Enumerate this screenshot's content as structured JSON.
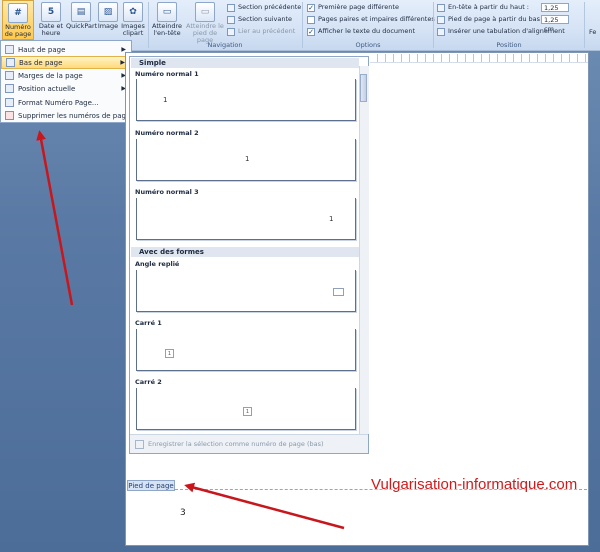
{
  "ribbon": {
    "buttons": [
      {
        "label_line1": "Numéro",
        "label_line2": "de page"
      },
      {
        "label_line1": "Date et",
        "label_line2": "heure"
      },
      {
        "label_line1": "QuickPart",
        "label_line2": ""
      },
      {
        "label_line1": "Image",
        "label_line2": ""
      },
      {
        "label_line1": "Images",
        "label_line2": "clipart"
      }
    ],
    "nav_buttons": [
      {
        "label_line1": "Atteindre",
        "label_line2": "l'en-tête"
      },
      {
        "label_line1": "Atteindre le",
        "label_line2": "pied de page"
      }
    ],
    "nav_rows": [
      "Section précédente",
      "Section suivante",
      "Lier au précédent"
    ],
    "nav_group": "Navigation",
    "options": [
      {
        "label": "Première page différente",
        "checked": true
      },
      {
        "label": "Pages paires et impaires différentes",
        "checked": false
      },
      {
        "label": "Afficher le texte du document",
        "checked": true
      }
    ],
    "options_group": "Options",
    "position": [
      {
        "label": "En-tête à partir du haut :",
        "value": "1,25 cm"
      },
      {
        "label": "Pied de page à partir du bas :",
        "value": "1,25 cm"
      }
    ],
    "position_row3": "Insérer une tabulation d'alignement",
    "position_group": "Position",
    "right_cut_label": "Fe"
  },
  "menu": {
    "items": [
      {
        "label": "Haut de page",
        "submenu": true
      },
      {
        "label": "Bas de page",
        "submenu": true,
        "selected": true
      },
      {
        "label": "Marges de la page",
        "submenu": true
      },
      {
        "label": "Position actuelle",
        "submenu": true
      },
      {
        "label": "Format Numéro Page...",
        "submenu": false
      },
      {
        "label": "Supprimer les numéros de page",
        "submenu": false
      }
    ]
  },
  "gallery": {
    "section_simple": "Simple",
    "section_formes": "Avec des formes",
    "items": [
      {
        "label": "Numéro normal 1"
      },
      {
        "label": "Numéro normal 2"
      },
      {
        "label": "Numéro normal 3"
      },
      {
        "label": "Angle replié"
      },
      {
        "label": "Carré 1"
      },
      {
        "label": "Carré 2"
      }
    ],
    "thumb_number": "1",
    "footer_action": "Enregistrer la sélection comme numéro de page (bas)"
  },
  "document": {
    "footer_tab": "Pied de page",
    "page_number": "3",
    "watermark": "Vulgarisation-informatique.com"
  },
  "colors": {
    "arrow": "#c8171c",
    "watermark": "#d2191a",
    "selected_menu": "#ffd97a"
  }
}
